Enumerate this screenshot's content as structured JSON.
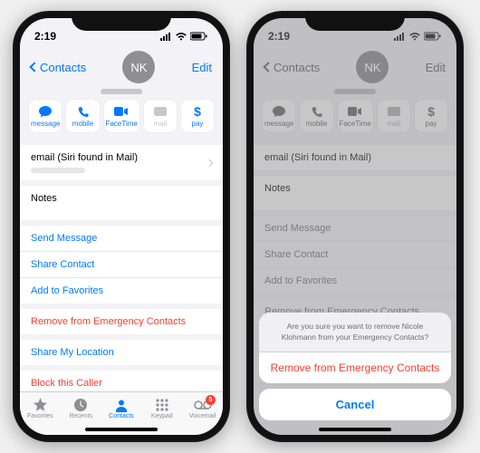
{
  "status": {
    "time": "2:19"
  },
  "nav": {
    "back": "Contacts",
    "edit": "Edit",
    "initials": "NK"
  },
  "quick": {
    "message": "message",
    "mobile": "mobile",
    "facetime": "FaceTime",
    "mail": "mail",
    "pay": "pay"
  },
  "email_row": {
    "label": "email (Siri found in Mail)"
  },
  "notes_label": "Notes",
  "actions": {
    "sendMessage": "Send Message",
    "shareContact": "Share Contact",
    "addFavorites": "Add to Favorites",
    "removeEmergency": "Remove from Emergency Contacts",
    "shareLocation": "Share My Location",
    "block": "Block this Caller"
  },
  "tabs": {
    "favorites": "Favorites",
    "recents": "Recents",
    "contacts": "Contacts",
    "keypad": "Keypad",
    "voicemail": "Voicemail",
    "voicemail_badge": "5"
  },
  "sheet": {
    "message": "Are you sure you want to remove Nicole Klohmann from your Emergency Contacts?",
    "confirm": "Remove from Emergency Contacts",
    "cancel": "Cancel"
  }
}
